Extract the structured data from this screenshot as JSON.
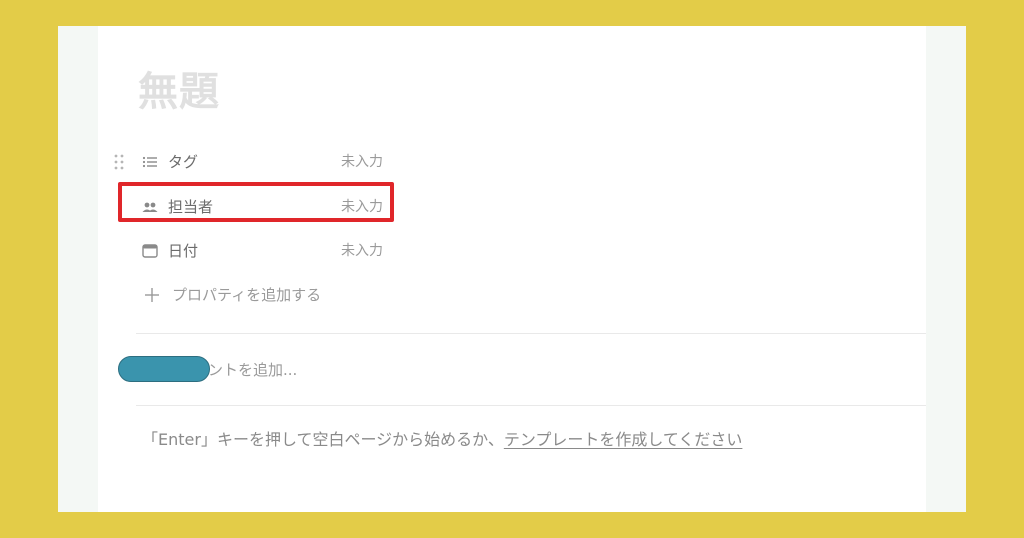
{
  "page": {
    "title": "無題"
  },
  "properties": [
    {
      "name": "タグ",
      "value": "未入力",
      "icon": "list-icon"
    },
    {
      "name": "担当者",
      "value": "未入力",
      "icon": "people-icon"
    },
    {
      "name": "日付",
      "value": "未入力",
      "icon": "calendar-icon"
    }
  ],
  "add_property": {
    "label": "プロパティを追加する",
    "icon": "plus-icon"
  },
  "comment": {
    "placeholder": "ントを追加..."
  },
  "hint": {
    "prefix": "「Enter」キーを押して空白ページから始めるか、",
    "link": "テンプレートを作成してください"
  },
  "colors": {
    "background": "#e3cc48",
    "highlight": "#e0262a",
    "redaction": "#3a94ad"
  }
}
